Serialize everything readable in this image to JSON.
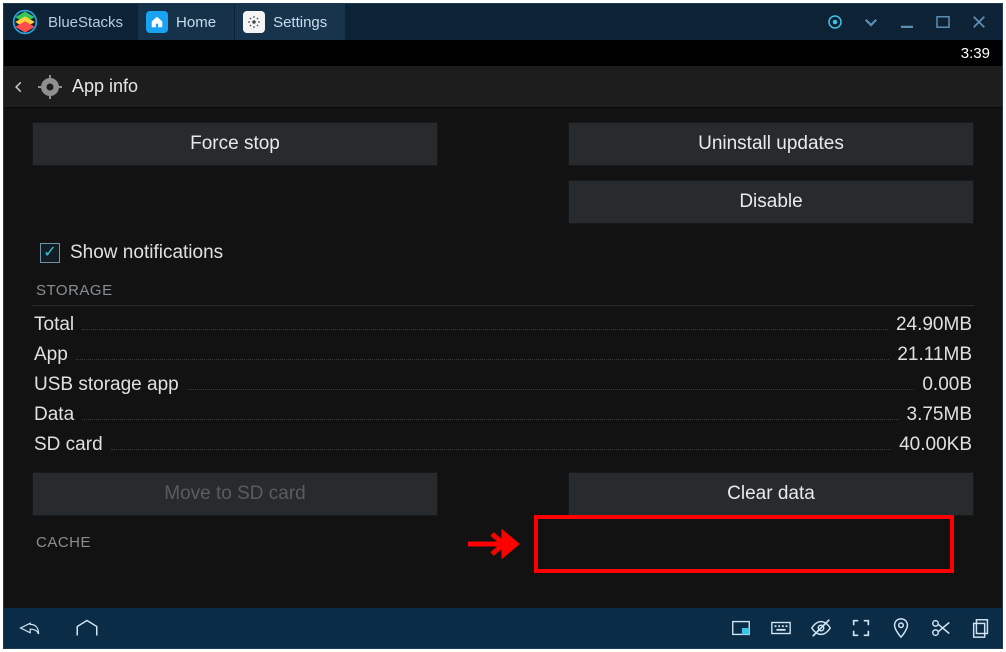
{
  "titlebar": {
    "app_name": "BlueStacks",
    "tabs": [
      {
        "label": "Home"
      },
      {
        "label": "Settings"
      }
    ]
  },
  "statusbar": {
    "time": "3:39"
  },
  "header": {
    "title": "App info"
  },
  "buttons": {
    "force_stop": "Force stop",
    "uninstall_updates": "Uninstall updates",
    "disable": "Disable",
    "move_sd": "Move to SD card",
    "clear_data": "Clear data"
  },
  "checkbox": {
    "show_notifications": "Show notifications",
    "checked": true
  },
  "sections": {
    "storage_label": "STORAGE",
    "cache_label": "CACHE"
  },
  "storage": [
    {
      "k": "Total",
      "v": "24.90MB"
    },
    {
      "k": "App",
      "v": "21.11MB"
    },
    {
      "k": "USB storage app",
      "v": "0.00B"
    },
    {
      "k": "Data",
      "v": "3.75MB"
    },
    {
      "k": "SD card",
      "v": "40.00KB"
    }
  ]
}
